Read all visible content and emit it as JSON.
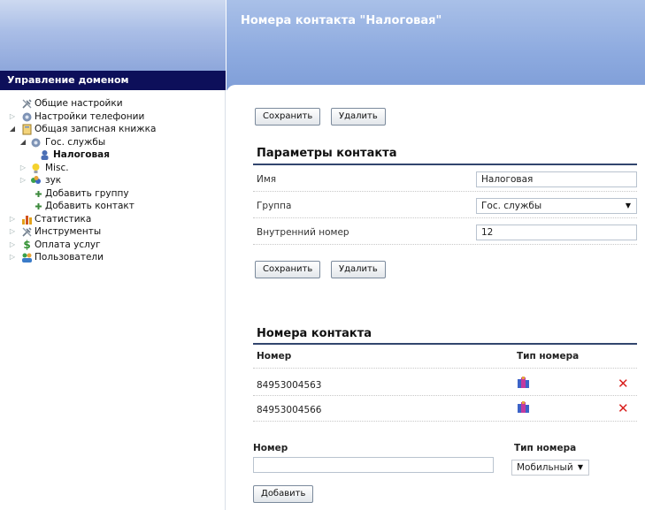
{
  "sidebar": {
    "title": "Управление доменом",
    "items": [
      {
        "label": "Общие настройки",
        "icon": "tools-icon"
      },
      {
        "label": "Настройки телефонии",
        "icon": "phone-settings-icon"
      },
      {
        "label": "Общая записная книжка",
        "icon": "address-book-icon"
      },
      {
        "label": "Гос. службы",
        "icon": "group-icon"
      },
      {
        "label": "Налоговая",
        "icon": "contact-icon"
      },
      {
        "label": "Misc.",
        "icon": "lightbulb-icon"
      },
      {
        "label": "зук",
        "icon": "group-icon"
      },
      {
        "label": "Добавить группу",
        "icon": "plus-icon"
      },
      {
        "label": "Добавить контакт",
        "icon": "plus-icon"
      },
      {
        "label": "Статистика",
        "icon": "chart-icon"
      },
      {
        "label": "Инструменты",
        "icon": "tools-icon"
      },
      {
        "label": "Оплата услуг",
        "icon": "dollar-icon"
      },
      {
        "label": "Пользователи",
        "icon": "users-icon"
      }
    ]
  },
  "header": {
    "title": "Номера контакта \"Налоговая\""
  },
  "buttons": {
    "save": "Сохранить",
    "delete": "Удалить",
    "add": "Добавить"
  },
  "params": {
    "title": "Параметры контакта",
    "fields": [
      {
        "label": "Имя",
        "value": "Налоговая"
      },
      {
        "label": "Группа",
        "value": "Гос. службы"
      },
      {
        "label": "Внутренний номер",
        "value": "12"
      }
    ]
  },
  "numbers": {
    "title": "Номера контакта",
    "col_number": "Номер",
    "col_type": "Тип номера",
    "rows": [
      {
        "number": "84953004563"
      },
      {
        "number": "84953004566"
      }
    ]
  },
  "add_form": {
    "number_label": "Номер",
    "number_value": "",
    "type_label": "Тип номера",
    "type_value": "Мобильный"
  },
  "colors": {
    "sidebar_title_bg": "#0d0f5a",
    "accent_line": "#32466e",
    "delete_red": "#d9201e"
  }
}
